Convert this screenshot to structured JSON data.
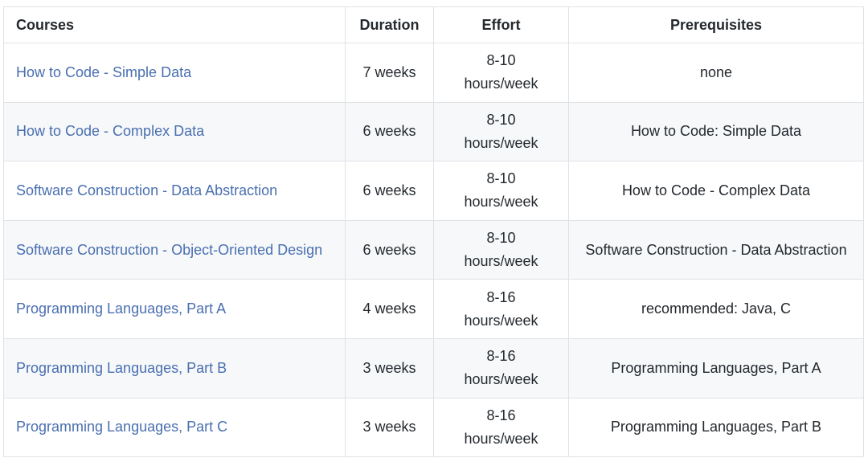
{
  "table": {
    "headers": {
      "courses": "Courses",
      "duration": "Duration",
      "effort": "Effort",
      "prerequisites": "Prerequisites"
    },
    "rows": [
      {
        "course": "How to Code - Simple Data",
        "duration": "7 weeks",
        "effort_range": "8-10",
        "effort_unit": "hours/week",
        "prerequisites": "none"
      },
      {
        "course": "How to Code - Complex Data",
        "duration": "6 weeks",
        "effort_range": "8-10",
        "effort_unit": "hours/week",
        "prerequisites": "How to Code: Simple Data"
      },
      {
        "course": "Software Construction - Data Abstraction",
        "duration": "6 weeks",
        "effort_range": "8-10",
        "effort_unit": "hours/week",
        "prerequisites": "How to Code - Complex Data"
      },
      {
        "course": "Software Construction - Object-Oriented Design",
        "duration": "6 weeks",
        "effort_range": "8-10",
        "effort_unit": "hours/week",
        "prerequisites": "Software Construction - Data Abstraction"
      },
      {
        "course": "Programming Languages, Part A",
        "duration": "4 weeks",
        "effort_range": "8-16",
        "effort_unit": "hours/week",
        "prerequisites": "recommended: Java, C"
      },
      {
        "course": "Programming Languages, Part B",
        "duration": "3 weeks",
        "effort_range": "8-16",
        "effort_unit": "hours/week",
        "prerequisites": "Programming Languages, Part A"
      },
      {
        "course": "Programming Languages, Part C",
        "duration": "3 weeks",
        "effort_range": "8-16",
        "effort_unit": "hours/week",
        "prerequisites": "Programming Languages, Part B"
      }
    ]
  },
  "colors": {
    "link": "#4a6fb0",
    "border": "#dfe2e5",
    "stripe": "#f6f8fa",
    "text": "#24292e"
  }
}
